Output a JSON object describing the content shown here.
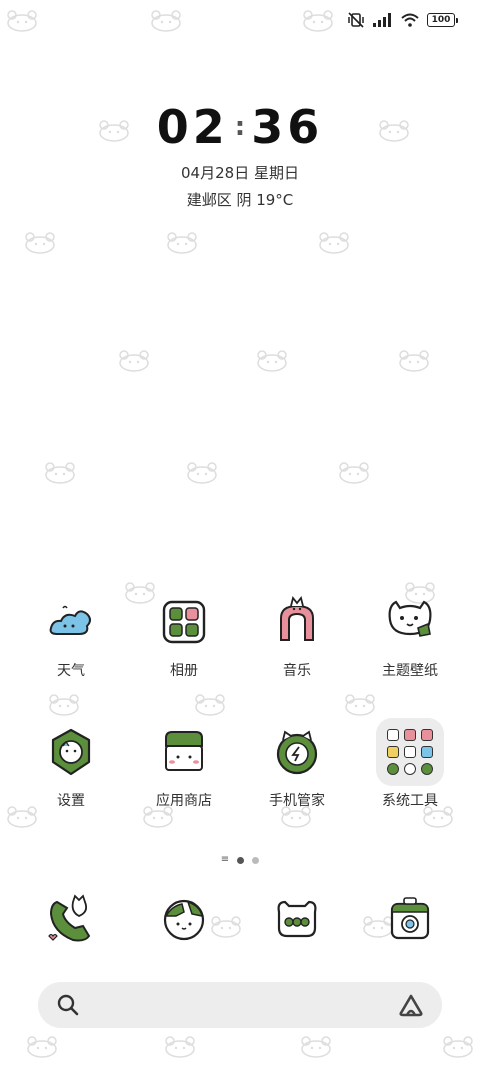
{
  "status_bar": {
    "icons": [
      "mute-vibrate-icon",
      "signal-icon",
      "wifi-icon",
      "battery-icon"
    ],
    "battery": "100"
  },
  "clock": {
    "hours": "02",
    "separator": ":",
    "minutes": "36"
  },
  "date": "04月28日 星期日",
  "weather": "建邺区 阴 19°C",
  "apps": [
    {
      "label": "天气",
      "icon": "weather-icon"
    },
    {
      "label": "相册",
      "icon": "gallery-icon"
    },
    {
      "label": "音乐",
      "icon": "music-icon"
    },
    {
      "label": "主题壁纸",
      "icon": "themes-icon"
    },
    {
      "label": "设置",
      "icon": "settings-icon"
    },
    {
      "label": "应用商店",
      "icon": "app-store-icon"
    },
    {
      "label": "手机管家",
      "icon": "security-icon"
    },
    {
      "label": "系统工具",
      "icon": "folder-icon"
    }
  ],
  "dock": [
    {
      "icon": "phone-icon"
    },
    {
      "icon": "browser-icon"
    },
    {
      "icon": "messages-icon"
    },
    {
      "icon": "camera-icon"
    }
  ],
  "search": {
    "icon": "search-icon",
    "assistant_icon": "assistant-icon"
  },
  "pager": {
    "pages": 2,
    "current": 1
  },
  "colors": {
    "accent_green": "#5b8f3c",
    "pink": "#e8909c",
    "blue": "#7cc3e8",
    "folder_bg": "#ececec"
  }
}
